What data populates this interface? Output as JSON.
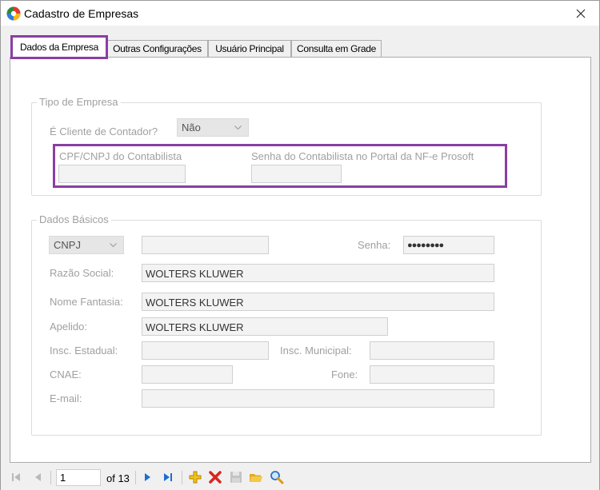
{
  "window": {
    "title": "Cadastro de Empresas"
  },
  "tabs": [
    {
      "label": "Dados da Empresa",
      "active": true
    },
    {
      "label": "Outras Configurações",
      "active": false
    },
    {
      "label": "Usuário Principal",
      "active": false
    },
    {
      "label": "Consulta em Grade",
      "active": false
    }
  ],
  "tipo_empresa": {
    "title": "Tipo de Empresa",
    "cliente_contador_label": "É Cliente de Contador?",
    "cliente_contador_value": "Não",
    "cpf_cnpj_label": "CPF/CNPJ do Contabilista",
    "cpf_cnpj_value": "",
    "senha_portal_label": "Senha do Contabilista no Portal da NF-e Prosoft",
    "senha_portal_value": ""
  },
  "dados_basicos": {
    "title": "Dados Básicos",
    "doc_type_value": "CNPJ",
    "doc_number_value": "",
    "senha_label": "Senha:",
    "senha_value": "●●●●●●●●",
    "razao_social_label": "Razão Social:",
    "razao_social_value": "WOLTERS KLUWER",
    "nome_fantasia_label": "Nome Fantasia:",
    "nome_fantasia_value": "WOLTERS KLUWER",
    "apelido_label": "Apelido:",
    "apelido_value": "WOLTERS KLUWER",
    "insc_estadual_label": "Insc. Estadual:",
    "insc_estadual_value": "",
    "insc_municipal_label": "Insc. Municipal:",
    "insc_municipal_value": "",
    "cnae_label": "CNAE:",
    "cnae_value": "",
    "fone_label": "Fone:",
    "fone_value": "",
    "email_label": "E-mail:",
    "email_value": ""
  },
  "navigator": {
    "current_page": "1",
    "total_label": "of 13"
  },
  "colors": {
    "highlight": "#8a3ea3",
    "label_disabled": "#a0a0a0",
    "nav_blue": "#1c6fd1",
    "add_yellow": "#e8b400",
    "delete_red": "#d9261c"
  }
}
